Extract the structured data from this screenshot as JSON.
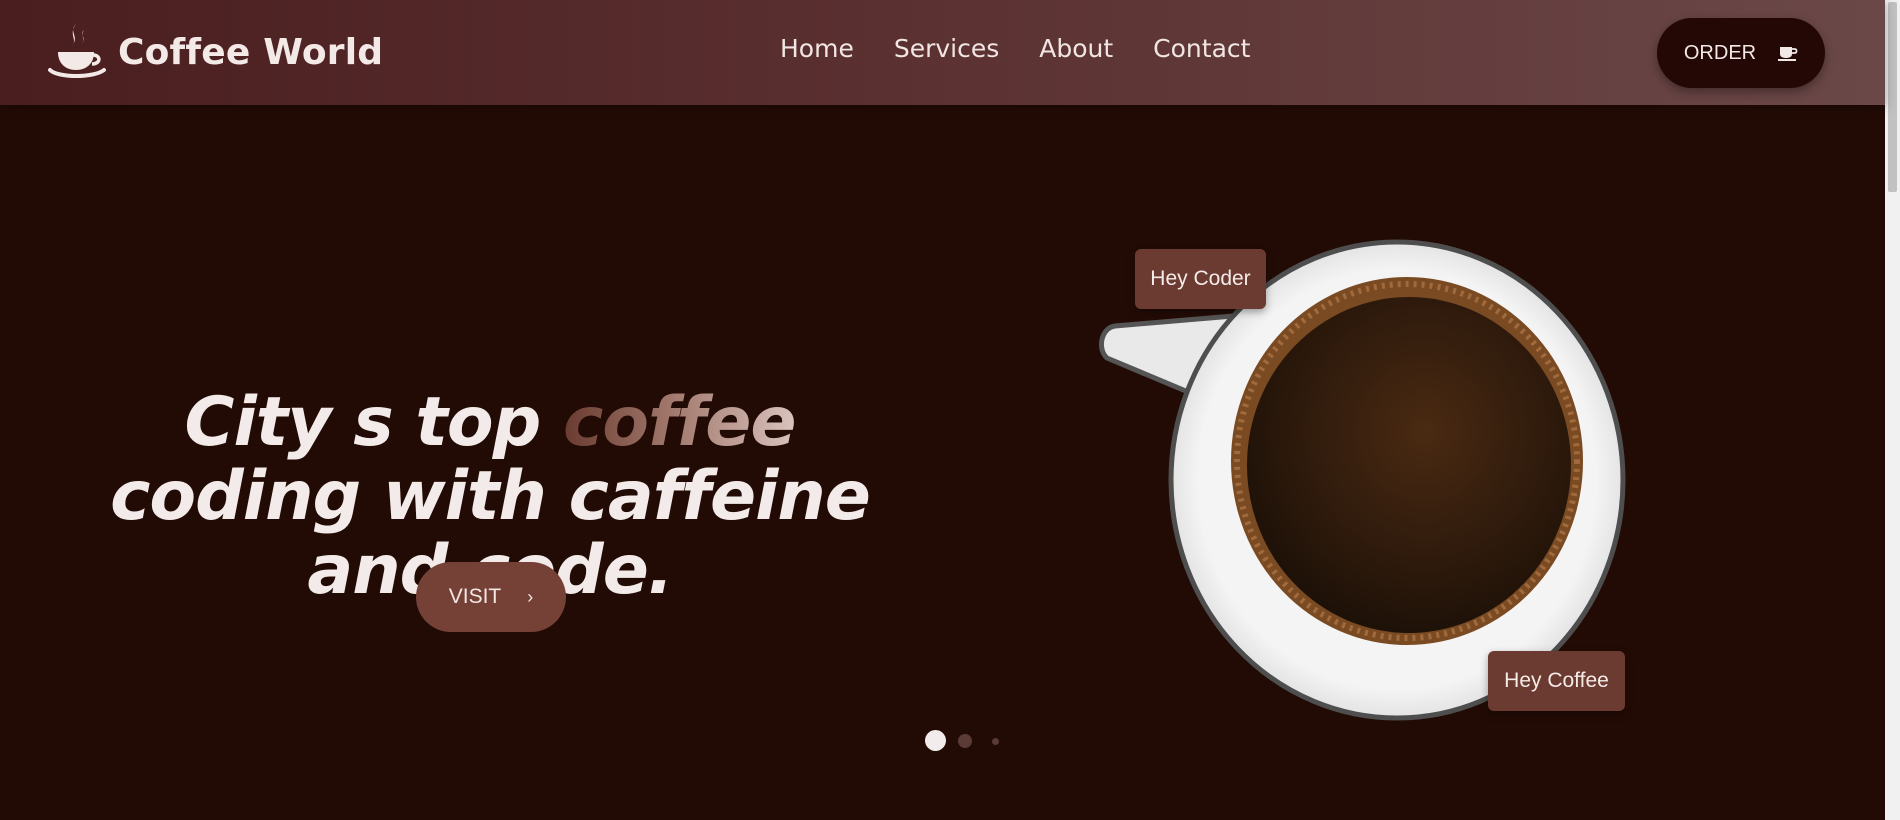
{
  "brand": {
    "name": "Coffee World",
    "icon": "coffee-steam-icon"
  },
  "nav": {
    "items": [
      "Home",
      "Services",
      "About",
      "Contact"
    ]
  },
  "order_button": {
    "label": "ORDER",
    "icon": "coffee-cup-icon"
  },
  "hero": {
    "headline_before": "City s top ",
    "headline_accent": "coffee",
    "headline_after": " coding with caffeine and code.",
    "visit_label": "VISIT",
    "visit_icon": "chevron-right-icon",
    "tag_left": "Hey Coder",
    "tag_right": "Hey Coffee"
  },
  "carousel": {
    "slides": 3,
    "active": 1
  },
  "colors": {
    "background": "#230b05",
    "header": "#5a2f2f",
    "accent": "#754136",
    "order_button": "#230806"
  }
}
